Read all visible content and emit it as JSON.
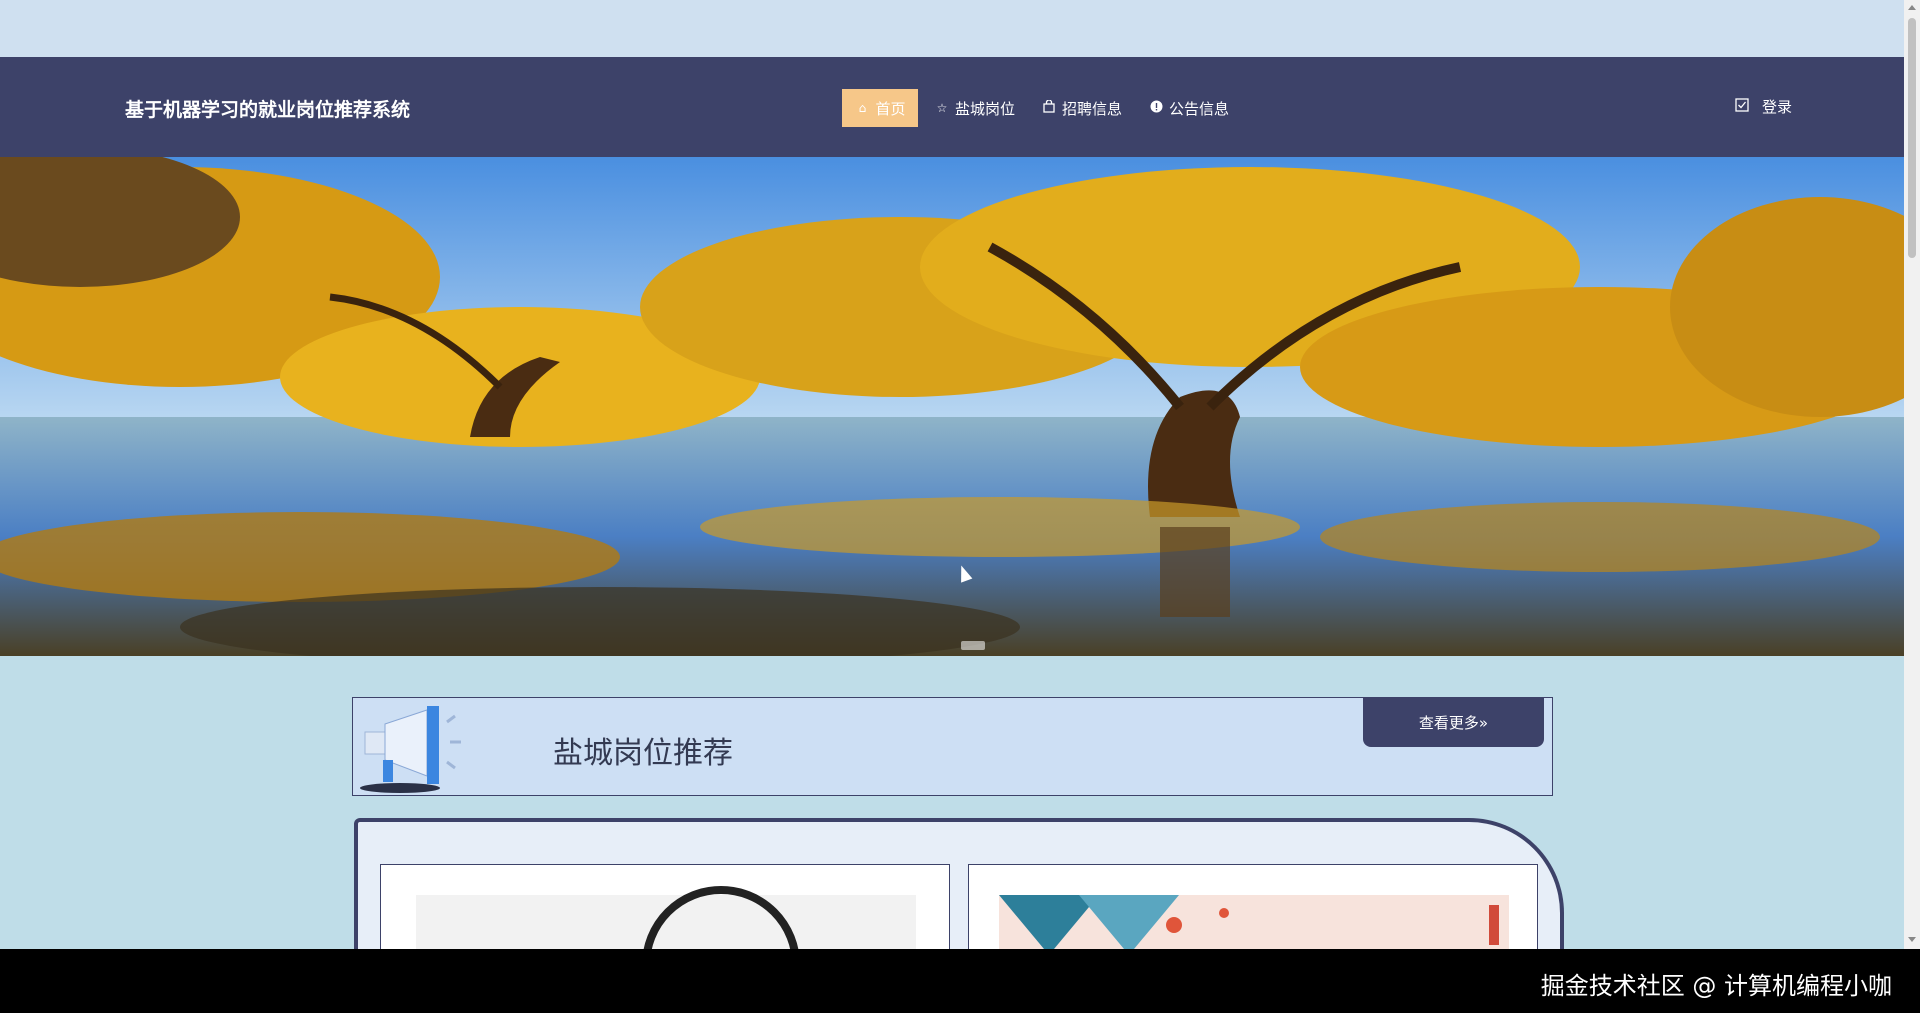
{
  "header": {
    "site_title": "基于机器学习的就业岗位推荐系统",
    "nav": [
      {
        "label": "首页",
        "icon": "home-icon",
        "active": true
      },
      {
        "label": "盐城岗位",
        "icon": "star-icon",
        "active": false
      },
      {
        "label": "招聘信息",
        "icon": "bag-icon",
        "active": false
      },
      {
        "label": "公告信息",
        "icon": "info-icon",
        "active": false
      }
    ],
    "login_label": "登录",
    "login_icon": "checkbox-icon"
  },
  "banner": {
    "description_icon": "banner-image"
  },
  "section": {
    "title": "盐城岗位推荐",
    "more_label": "查看更多»",
    "illustration_icon": "megaphone-icon"
  },
  "overlay": {
    "watermark": "掘金技术社区 @ 计算机编程小咖"
  },
  "colors": {
    "navbar": "#3d4269",
    "active_nav": "#f6c789",
    "page_bg": "#bfdde8",
    "section_bg": "#cddff4"
  }
}
